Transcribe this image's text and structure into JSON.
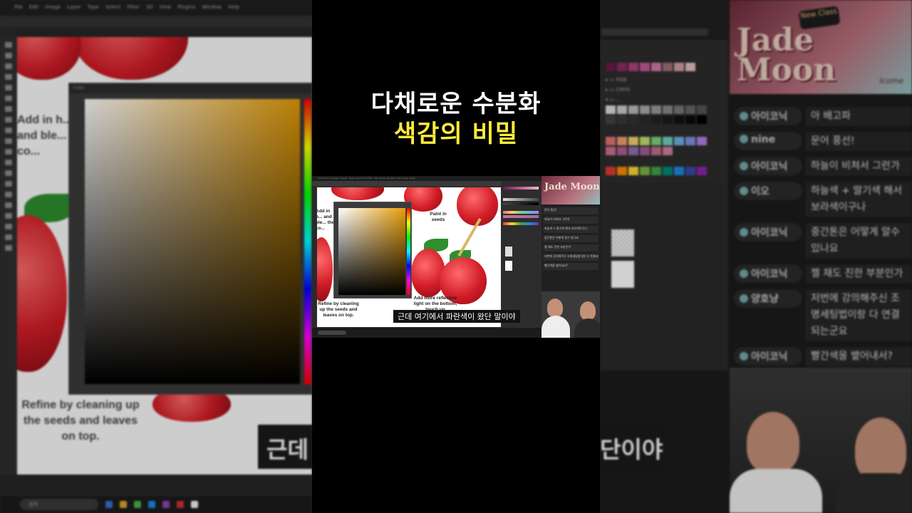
{
  "title": {
    "line1": "다채로운 수분화",
    "line2": "색감의 비밀",
    "line1_color": "#ffffff",
    "line2_color": "#ffeb3b"
  },
  "video_caption": "근데 여기에서 파란색이 왔단 말이야",
  "bg_caption_fragments": {
    "left": "근데",
    "right": "단이야"
  },
  "canvas_notes": {
    "add_in": "Add in h... and ble... the co...",
    "paint_seeds": "Paint in seeds",
    "refine": "Refine by cleaning up the seeds and leaves on top.",
    "reflective": "Add more reflective light on the bottom, touch up"
  },
  "stream_brand": {
    "logo": "Jade Moon",
    "badge": "New Class",
    "signature": "Icome"
  },
  "chat": [
    {
      "user": "아이코닉",
      "message": "아 배고파"
    },
    {
      "user": "nine",
      "message": "문어 풍선!"
    },
    {
      "user": "아이코닉",
      "message": "하늘이 비쳐서 그런가"
    },
    {
      "user": "이오",
      "message": "하늘색 + 딸기색 해서 보라색이구나"
    },
    {
      "user": "아이코닉",
      "message": "중간톤은 어떻게 알수 있나요"
    },
    {
      "user": "아이코닉",
      "message": "젤 채도 진한 부분인가"
    },
    {
      "user": "양호냥",
      "message": "저번에 강의해주신 조명세팅법이랑 다 연결되는군요"
    },
    {
      "user": "아이코닉",
      "message": "빨간색을 뱉어내서?"
    }
  ],
  "photoshop": {
    "menu": [
      "File",
      "Edit",
      "Image",
      "Layer",
      "Type",
      "Select",
      "Filter",
      "3D",
      "View",
      "Plugins",
      "Window",
      "Help"
    ],
    "panel_title": "Color",
    "taskbar_search": "검색"
  },
  "colors": {
    "accent_yellow": "#ffeb3b",
    "strawberry": "#d21d27",
    "color_picker_hue": "#e59c06"
  }
}
